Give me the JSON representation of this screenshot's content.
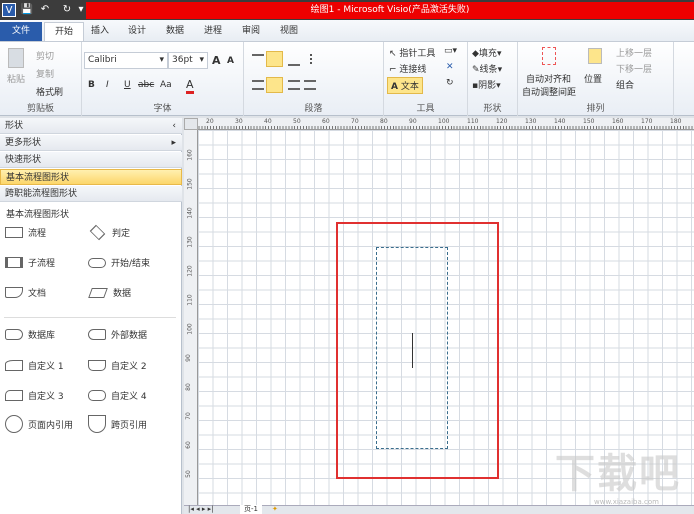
{
  "window": {
    "title": "绘图1 - Microsoft Visio(产品激活失败)"
  },
  "quick_access": {
    "app": "V",
    "save": "💾",
    "undo": "↶",
    "redo": "↻",
    "more": "▾"
  },
  "tabs": [
    "文件",
    "开始",
    "插入",
    "设计",
    "数据",
    "进程",
    "审阅",
    "视图"
  ],
  "ribbon": {
    "clipboard": {
      "label": "剪贴板",
      "paste": "粘贴",
      "cut": "剪切",
      "copy": "复制",
      "format_painter": "格式刷"
    },
    "font": {
      "label": "字体",
      "font_name": "Calibri",
      "font_size": "36pt",
      "bold": "B",
      "italic": "I",
      "underline": "U",
      "strike": "abc",
      "case": "Aa",
      "color": "A",
      "grow": "A",
      "shrink": "A"
    },
    "paragraph": {
      "label": "段落"
    },
    "tools": {
      "label": "工具",
      "pointer": "指针工具",
      "connector": "连接线",
      "text": "文本"
    },
    "shape": {
      "label": "形状",
      "fill": "填充",
      "line": "线条",
      "shadow": "阴影"
    },
    "arrange": {
      "label": "排列",
      "auto_align_1": "自动对齐和",
      "auto_align_2": "自动调整间距",
      "position": "位置",
      "bring_forward": "上移一层",
      "send_backward": "下移一层",
      "group": "组合"
    }
  },
  "shapes_pane": {
    "header": "形状",
    "more_shapes": "更多形状",
    "quick_shapes": "快速形状",
    "basic_flowchart": "基本流程图形状",
    "cross_functional": "跨职能流程图形状",
    "section_title": "基本流程图形状",
    "items": [
      "流程",
      "判定",
      "子流程",
      "开始/结束",
      "文档",
      "数据",
      "数据库",
      "外部数据",
      "自定义 1",
      "自定义 2",
      "自定义 3",
      "自定义 4",
      "页面内引用",
      "跨页引用"
    ]
  },
  "rulers": {
    "top": [
      "20",
      "30",
      "40",
      "50",
      "60",
      "70",
      "80",
      "90",
      "100",
      "110",
      "120",
      "130",
      "140",
      "150",
      "160",
      "170",
      "180"
    ],
    "left": [
      "160",
      "150",
      "140",
      "130",
      "120",
      "110",
      "100",
      "90",
      "80",
      "70",
      "60",
      "50"
    ]
  },
  "page_tabs": {
    "current": "页-1"
  },
  "watermark": {
    "text": "下载吧",
    "url": "www.xiazaiba.com"
  }
}
